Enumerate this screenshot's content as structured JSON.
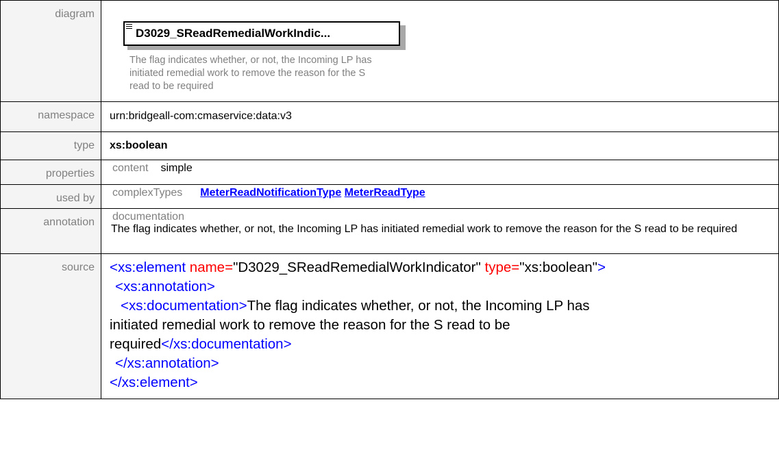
{
  "labels": {
    "diagram": "diagram",
    "namespace": "namespace",
    "type": "type",
    "properties": "properties",
    "used_by": "used by",
    "annotation": "annotation",
    "source": "source"
  },
  "diagram": {
    "element_title": "D3029_SReadRemedialWorkIndic...",
    "description": "The flag indicates whether, or not, the Incoming LP has initiated remedial work to remove the reason for the S read to be required"
  },
  "namespace": "urn:bridgeall-com:cmaservice:data:v3",
  "type": "xs:boolean",
  "properties": {
    "key": "content",
    "value": "simple"
  },
  "used_by": {
    "key": "complexTypes",
    "links": [
      "MeterReadNotificationType",
      "MeterReadType"
    ]
  },
  "annotation": {
    "key": "documentation",
    "text": "The flag indicates whether, or not, the Incoming LP has initiated remedial work to remove the reason for the S read to be required"
  },
  "source": {
    "open_tag": "<xs:element",
    "attr_name": " name=",
    "name_value": "\"D3029_SReadRemedialWorkIndicator\"",
    "attr_type": " type=",
    "type_value": "\"xs:boolean\"",
    "close_bracket": ">",
    "annotation_open": "<xs:annotation>",
    "documentation_open": "<xs:documentation>",
    "documentation_text_1": "The flag indicates whether, or not, the Incoming LP has",
    "documentation_text_2": "initiated remedial work to remove the reason for the S read to be",
    "documentation_text_3": "required",
    "documentation_close": "</xs:documentation>",
    "annotation_close": "</xs:annotation>",
    "element_close": "</xs:element>"
  }
}
